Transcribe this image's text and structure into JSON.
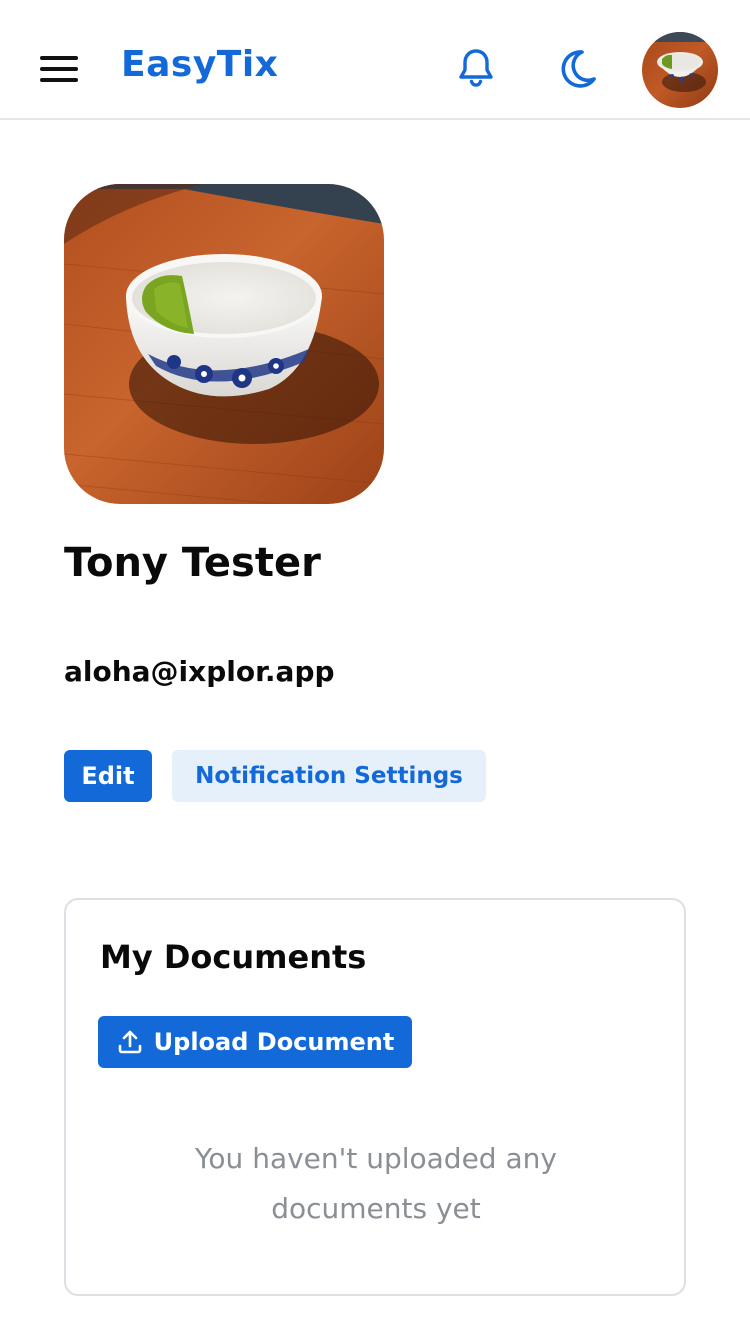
{
  "header": {
    "brand": "EasyTix",
    "menu_icon": "hamburger-menu-icon",
    "notification_icon": "bell-icon",
    "theme_icon": "moon-icon",
    "avatar_alt": "matcha-latte-avatar"
  },
  "profile": {
    "name": "Tony Tester",
    "email": "aloha@ixplor.app",
    "edit_label": "Edit",
    "notification_settings_label": "Notification Settings"
  },
  "documents": {
    "title": "My Documents",
    "upload_label": "Upload Document",
    "upload_icon": "upload-icon",
    "empty_message": "You haven't uploaded any documents yet"
  },
  "colors": {
    "accent": "#1369d8",
    "accent_light": "#e6f0fb",
    "muted_text": "#8a8f96",
    "border": "#dcdfe3"
  }
}
